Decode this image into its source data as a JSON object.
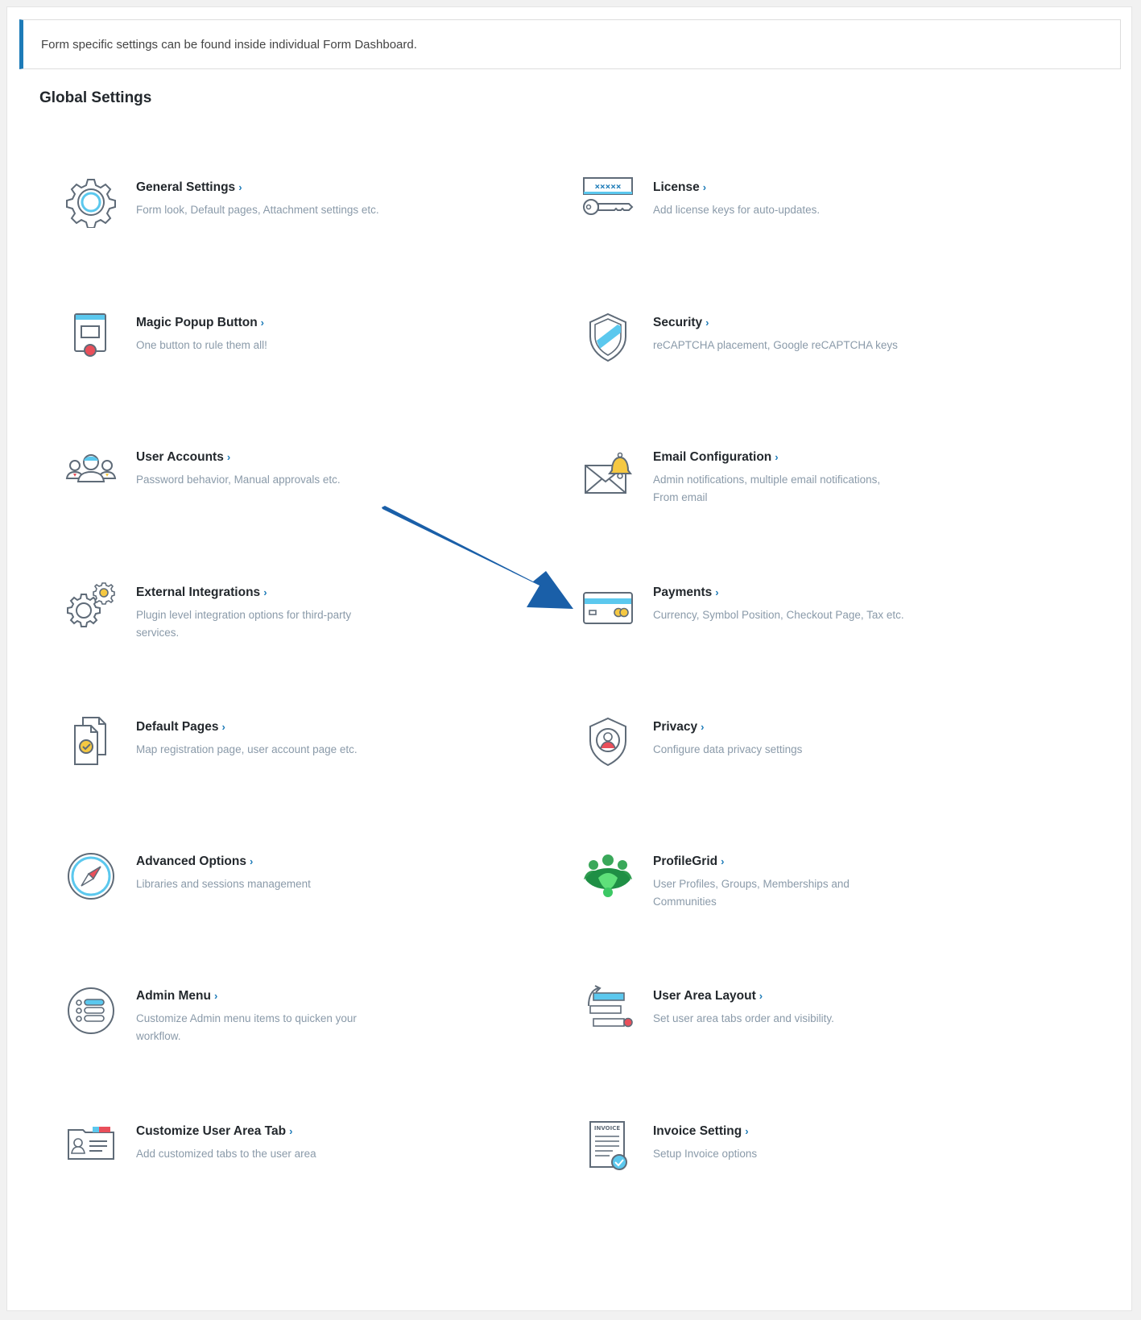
{
  "notice": "Form specific settings can be found inside individual Form Dashboard.",
  "heading": "Global Settings",
  "chevron": "›",
  "left": [
    {
      "title": "General Settings",
      "desc": "Form look, Default pages, Attachment settings etc.",
      "icon": "gear-icon"
    },
    {
      "title": "Magic Popup Button",
      "desc": "One button to rule them all!",
      "icon": "popup-button-icon"
    },
    {
      "title": "User Accounts",
      "desc": "Password behavior, Manual approvals etc.",
      "icon": "users-icon"
    },
    {
      "title": "External Integrations",
      "desc": "Plugin level integration options for third-party services.",
      "icon": "gears-icon"
    },
    {
      "title": "Default Pages",
      "desc": "Map registration page, user account page etc.",
      "icon": "pages-icon"
    },
    {
      "title": "Advanced Options",
      "desc": "Libraries and sessions management",
      "icon": "compass-icon"
    },
    {
      "title": "Admin Menu",
      "desc": "Customize Admin menu items to quicken your workflow.",
      "icon": "menu-list-icon"
    },
    {
      "title": "Customize User Area Tab",
      "desc": "Add customized tabs to the user area",
      "icon": "id-card-tab-icon"
    }
  ],
  "right": [
    {
      "title": "License",
      "desc": "Add license keys for auto-updates.",
      "icon": "license-key-icon"
    },
    {
      "title": "Security",
      "desc": "reCAPTCHA placement, Google reCAPTCHA keys",
      "icon": "shield-icon"
    },
    {
      "title": "Email Configuration",
      "desc": "Admin notifications, multiple email notifications, From email",
      "icon": "email-bell-icon"
    },
    {
      "title": "Payments",
      "desc": "Currency, Symbol Position, Checkout Page, Tax etc.",
      "icon": "credit-card-icon"
    },
    {
      "title": "Privacy",
      "desc": "Configure data privacy settings",
      "icon": "privacy-shield-icon"
    },
    {
      "title": "ProfileGrid",
      "desc": "User Profiles, Groups, Memberships and Communities",
      "icon": "profilegrid-icon"
    },
    {
      "title": "User Area Layout",
      "desc": "Set user area tabs order and visibility.",
      "icon": "layout-icon"
    },
    {
      "title": "Invoice Setting",
      "desc": "Setup Invoice options",
      "icon": "invoice-icon"
    }
  ],
  "colors": {
    "accent": "#1d7bb8",
    "arrow": "#1a5fa8",
    "icon_blue": "#5bc8ee",
    "icon_red": "#e94f5a",
    "icon_yellow": "#f5c842"
  },
  "invoice_label": "INVOICE",
  "license_mask": "×××××"
}
